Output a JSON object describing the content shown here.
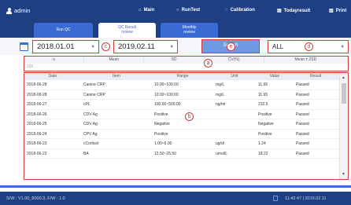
{
  "header": {
    "user": "admin",
    "nav": [
      {
        "label": "Main",
        "icon": "home-icon",
        "glyph": "⌂"
      },
      {
        "label": "RunTest",
        "icon": "runtest-icon",
        "glyph": "○"
      },
      {
        "label": "Calibration",
        "icon": "calibration-icon",
        "glyph": "◌"
      },
      {
        "label": "Todayresult",
        "icon": "todayresult-icon",
        "glyph": "▤"
      },
      {
        "label": "Print",
        "icon": "print-icon",
        "glyph": "▥"
      }
    ]
  },
  "tabs": [
    {
      "line1": "Run QC",
      "line2": ""
    },
    {
      "line1": "QC Result",
      "line2": "review"
    },
    {
      "line1": "Monthly",
      "line2": "review"
    }
  ],
  "filter": {
    "date_from": "2018.01.01",
    "date_to": "2019.02.11",
    "search_label": "Search",
    "item_value": "ALL",
    "marker_c": "c",
    "marker_e": "e",
    "marker_d": "d"
  },
  "stats": {
    "headers": [
      "n",
      "Mean",
      "SD",
      "CV(%)",
      "Mean ± 2SD"
    ],
    "value": "225",
    "marker_a": "a"
  },
  "table": {
    "headers": [
      "Date",
      "Item",
      "Range",
      "Unit",
      "Value",
      "Result"
    ],
    "rows": [
      [
        "2018-06-28",
        "Canine CRP",
        "10.00~100.00",
        "mg/L",
        "11.65",
        "Passed"
      ],
      [
        "2018-06-28",
        "Canine CRP",
        "10.00~100.00",
        "mg/L",
        "11.65",
        "Passed"
      ],
      [
        "2018-06-27",
        "cPL",
        "100.00~500.00",
        "ng/ml",
        "232.5",
        "Passed"
      ],
      [
        "2018-06-26",
        "CDV Ag",
        "Positive",
        "",
        "Positive",
        "Passed"
      ],
      [
        "2018-06-25",
        "CDV Ag",
        "Negative",
        "",
        "Negative",
        "Passed"
      ],
      [
        "2018-06-24",
        "CPV Ag",
        "Positive",
        "",
        "Positive",
        "Passed"
      ],
      [
        "2018-06-23",
        "cCortisol",
        "1.00~5.00",
        "ug/dl",
        "1.24",
        "Passed"
      ],
      [
        "2018-06-23",
        "BA",
        "12.50~25.50",
        "umol/L",
        "18.22",
        "Passed"
      ]
    ],
    "marker_b": "b"
  },
  "footer": {
    "version": "S/W : V1.00_8000.3, F/W : 1.0",
    "time": "11:42:47 | 2019.02.11"
  }
}
